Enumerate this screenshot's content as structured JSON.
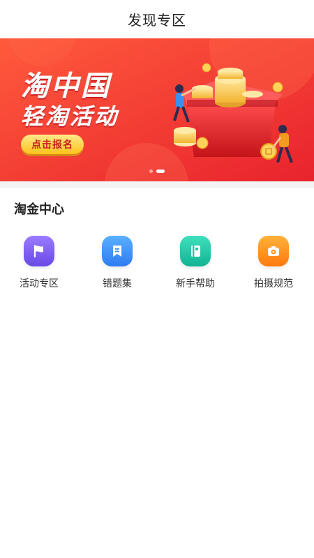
{
  "header": {
    "title": "发现专区"
  },
  "banner": {
    "line1": "淘中国",
    "line2": "轻淘活动",
    "cta": "点击报名",
    "slides": 2,
    "active_slide": 2,
    "background_color": "#f0393a"
  },
  "section": {
    "title": "淘金中心"
  },
  "grid": [
    {
      "label": "活动专区",
      "icon": "flag-icon",
      "color": "#7b5cf0"
    },
    {
      "label": "错题集",
      "icon": "bookmark-icon",
      "color": "#3b8cf7"
    },
    {
      "label": "新手帮助",
      "icon": "book-icon",
      "color": "#22c7a5"
    },
    {
      "label": "拍摄规范",
      "icon": "camera-icon",
      "color": "#ff8a16"
    }
  ]
}
